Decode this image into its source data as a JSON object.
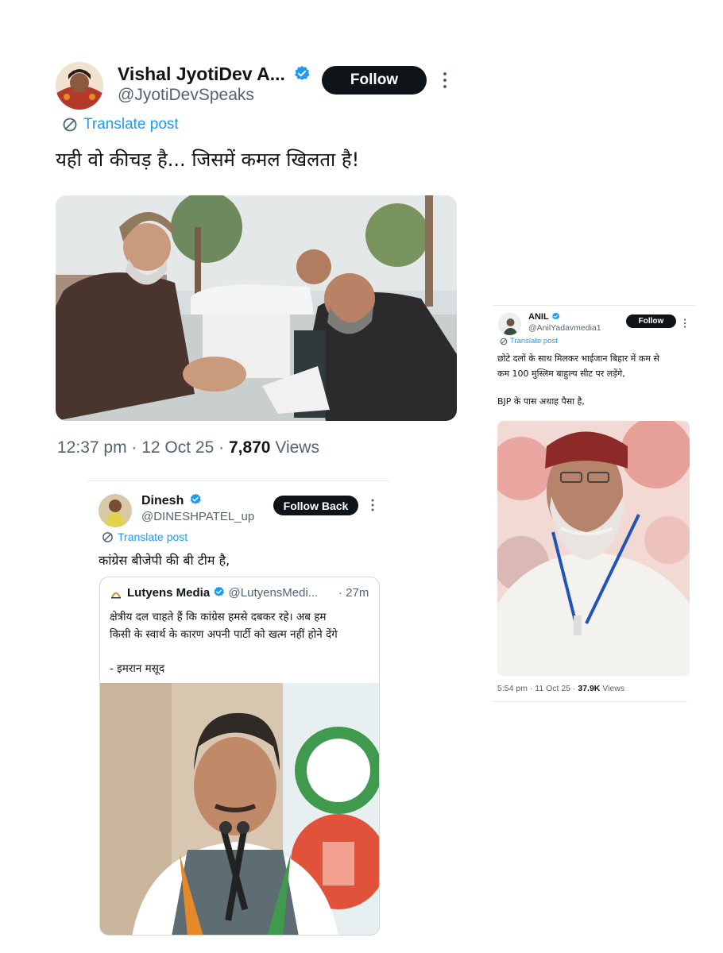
{
  "main_post": {
    "display_name": "Vishal JyotiDev A...",
    "handle": "@JyotiDevSpeaks",
    "follow_label": "Follow",
    "translate_label": "Translate post",
    "text": "यही वो कीचड़ है... जिसमें कमल खिलता है!",
    "time": "12:37 pm · 12 Oct 25 · ",
    "views_count": "7,870",
    "views_label": " Views"
  },
  "quote_post": {
    "display_name": "Dinesh",
    "handle": "@DINESHPATEL_up",
    "follow_label": "Follow Back",
    "translate_label": "Translate post",
    "text": "कांग्रेस बीजेपी की बी टीम है,",
    "embedded": {
      "source_name": "Lutyens Media",
      "source_handle": "@LutyensMedi...",
      "time": "· 27m",
      "line1": "क्षेत्रीय दल चाहते हैं कि कांग्रेस हमसे दबकर रहे। अब हम",
      "line2": "किसी के स्वार्थ के कारण अपनी पार्टी को खत्म नहीं होने देंगे",
      "attribution": "- इमरान मसूद"
    }
  },
  "side_post": {
    "display_name": "ANIL",
    "handle": "@AnilYadavmedia1",
    "follow_label": "Follow",
    "translate_label": "Translate post",
    "text_line1": "छोटे दलों के साथ मिलकर भाईजान बिहार में कम से",
    "text_line2": "कम 100 मुस्लिम बाहुल्य सीट पर लड़ेंगे,",
    "text_line3": "BJP के पास अथाह पैसा है,",
    "time": "5:54 pm · 11 Oct 25 · ",
    "views_count": "37.9K",
    "views_label": " Views"
  },
  "colors": {
    "link": "#1d9bf0",
    "text": "#0f1419",
    "secondary": "#536471",
    "button": "#0f1419"
  }
}
